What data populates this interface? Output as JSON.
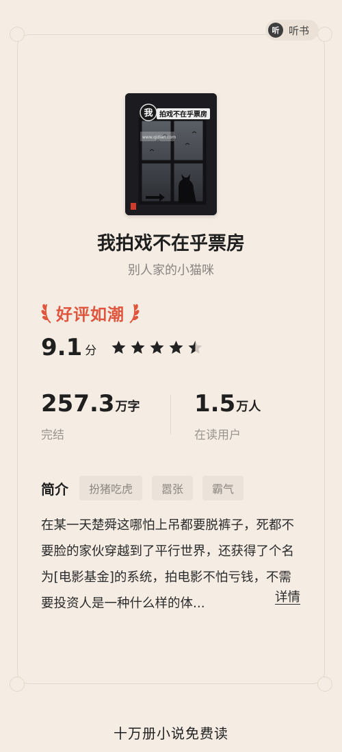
{
  "header": {
    "listen_icon_glyph": "听",
    "listen_label": "听书"
  },
  "book": {
    "cover_title_mark": "我",
    "cover_title_text": "拍戏不在乎票房",
    "cover_website": "www.qidian.com",
    "cover_author_vertical": "别人家的小猫咪",
    "title": "我拍戏不在乎票房",
    "author": "别人家的小猫咪"
  },
  "rating": {
    "badge": "好评如潮",
    "score": "9.1",
    "score_unit": "分",
    "stars_value": 4.5,
    "stars_max": 5,
    "accent_color": "#e0553d"
  },
  "stats": {
    "words": {
      "value": "257.3",
      "unit": "万字",
      "label": "完结"
    },
    "readers": {
      "value": "1.5",
      "unit": "万人",
      "label": "在读用户"
    }
  },
  "intro": {
    "label": "简介",
    "tags": [
      "扮猪吃虎",
      "嚣张",
      "霸气"
    ],
    "description": "在某一天楚舜这哪怕上吊都要脱裤子，死都不要脸的家伙穿越到了平行世界，还获得了个名为[电影基金]的系统，拍电影不怕亏钱，不需要投资人是一种什么样的体...",
    "details_label": "详情"
  },
  "footer": {
    "text": "十万册小说免费读"
  }
}
